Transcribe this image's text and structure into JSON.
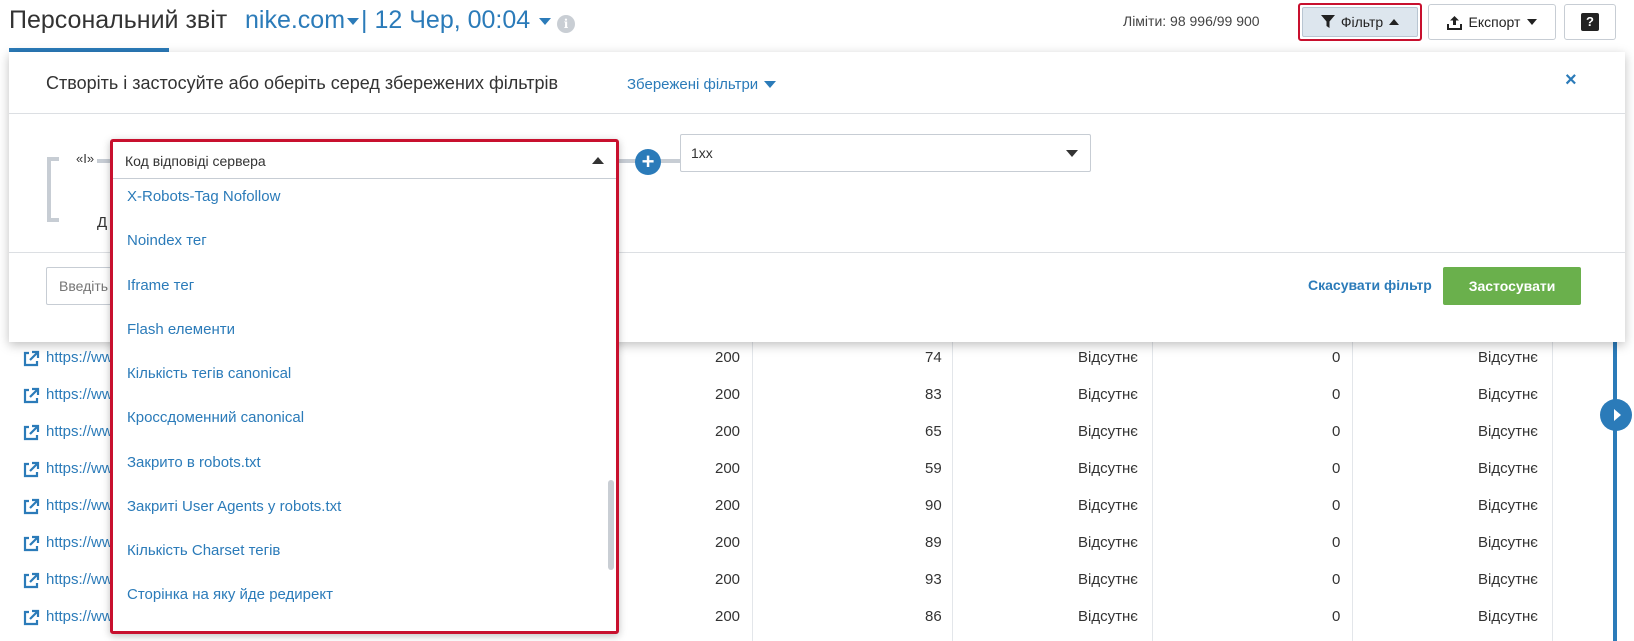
{
  "header": {
    "title": "Персональний звіт",
    "domain": "nike.com",
    "separator": "|",
    "date": "12 Чер, 00:04",
    "limits": "Ліміти: 98 996/99 900",
    "filter_label": "Фільтр",
    "export_label": "Експорт",
    "help_label": "?",
    "info_label": "i"
  },
  "filter_panel": {
    "title": "Створіть і застосуйте або оберіть серед збережених фільтрів",
    "saved_filters": "Збережені фільтри",
    "close": "×",
    "and_label": "«І»",
    "add_label": "Д",
    "value_select": "1xx",
    "search_placeholder": "Введіть",
    "cancel": "Скасувати фільтр",
    "apply": "Застосувати",
    "plus": "+"
  },
  "dropdown": {
    "selected": "Код відповіді сервера",
    "items": [
      "X-Robots-Tag Nofollow",
      "Noindex тег",
      "Iframe тег",
      "Flash елементи",
      "Кількість тегів canonical",
      "Кроссдоменний canonical",
      "Закрито в robots.txt",
      "Закриті User Agents у robots.txt",
      "Кількість Charset тегів",
      "Сторінка на яку йде редирект"
    ]
  },
  "table": {
    "rows": [
      {
        "url": "https://ww",
        "code": "200",
        "n1": "74",
        "s1": "Відсутнє",
        "n2": "0",
        "s2": "Відсутнє"
      },
      {
        "url": "https://ww",
        "code": "200",
        "n1": "83",
        "s1": "Відсутнє",
        "n2": "0",
        "s2": "Відсутнє"
      },
      {
        "url": "https://ww",
        "code": "200",
        "n1": "65",
        "s1": "Відсутнє",
        "n2": "0",
        "s2": "Відсутнє"
      },
      {
        "url": "https://ww",
        "code": "200",
        "n1": "59",
        "s1": "Відсутнє",
        "n2": "0",
        "s2": "Відсутнє"
      },
      {
        "url": "https://ww",
        "code": "200",
        "n1": "90",
        "s1": "Відсутнє",
        "n2": "0",
        "s2": "Відсутнє"
      },
      {
        "url": "https://ww",
        "code": "200",
        "n1": "89",
        "s1": "Відсутнє",
        "n2": "0",
        "s2": "Відсутнє"
      },
      {
        "url": "https://ww",
        "code": "200",
        "n1": "93",
        "s1": "Відсутнє",
        "n2": "0",
        "s2": "Відсутнє"
      },
      {
        "url": "https://ww",
        "code": "200",
        "n1": "86",
        "s1": "Відсутнє",
        "n2": "0",
        "s2": "Відсутнє"
      }
    ]
  },
  "colors": {
    "accent": "#2b7bb9",
    "highlight": "#c8102e",
    "apply": "#6ab04c"
  },
  "icons": [
    "info-icon",
    "funnel-icon",
    "upload-icon",
    "help-icon",
    "close-icon",
    "plus-icon",
    "external-link-icon",
    "chevron-right-icon"
  ]
}
